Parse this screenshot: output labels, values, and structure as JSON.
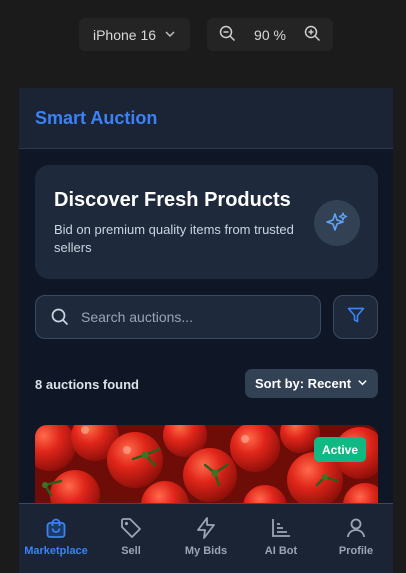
{
  "toolbar": {
    "device": "iPhone 16",
    "zoom": "90 %"
  },
  "app": {
    "title": "Smart Auction"
  },
  "hero": {
    "title": "Discover Fresh Products",
    "subtitle": "Bid on premium quality items from trusted sellers"
  },
  "search": {
    "placeholder": "Search auctions..."
  },
  "results": {
    "count_text": "8 auctions found",
    "sort_label": "Sort by: Recent"
  },
  "card": {
    "status": "Active",
    "colors": {
      "badge": "#10b981"
    }
  },
  "nav": {
    "items": [
      {
        "label": "Marketplace",
        "icon": "shopping-bag-icon",
        "active": true
      },
      {
        "label": "Sell",
        "icon": "tag-icon",
        "active": false
      },
      {
        "label": "My Bids",
        "icon": "lightning-icon",
        "active": false
      },
      {
        "label": "AI Bot",
        "icon": "chart-icon",
        "active": false
      },
      {
        "label": "Profile",
        "icon": "user-icon",
        "active": false
      }
    ]
  },
  "colors": {
    "accent": "#3b82f6",
    "background": "#0f1726",
    "surface": "#1e293b"
  }
}
